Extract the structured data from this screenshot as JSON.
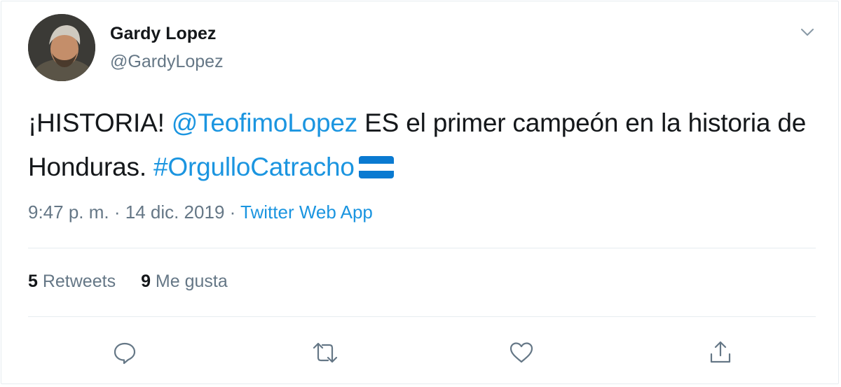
{
  "author": {
    "name": "Gardy Lopez",
    "handle": "@GardyLopez"
  },
  "tweet": {
    "prefix": "¡HISTORIA! ",
    "mention": "@TeofimoLopez",
    "middle": " ES el primer campeón en la historia de Honduras. ",
    "hashtag": "#OrgulloCatracho",
    "flag": "honduras-flag-emoji"
  },
  "meta": {
    "time": "9:47 p. m.",
    "separator": " · ",
    "date": "14 dic. 2019",
    "separator2": " · ",
    "source": "Twitter Web App"
  },
  "stats": {
    "retweets_count": "5",
    "retweets_label": " Retweets",
    "likes_count": "9",
    "likes_label": " Me gusta"
  },
  "icons": {
    "reply": "reply-icon",
    "retweet": "retweet-icon",
    "like": "heart-icon",
    "share": "share-icon",
    "menu": "chevron-down-icon"
  },
  "colors": {
    "link": "#1b95e0",
    "secondary_text": "#657786",
    "primary_text": "#14171a",
    "flag_blue": "#0a7ad1"
  }
}
